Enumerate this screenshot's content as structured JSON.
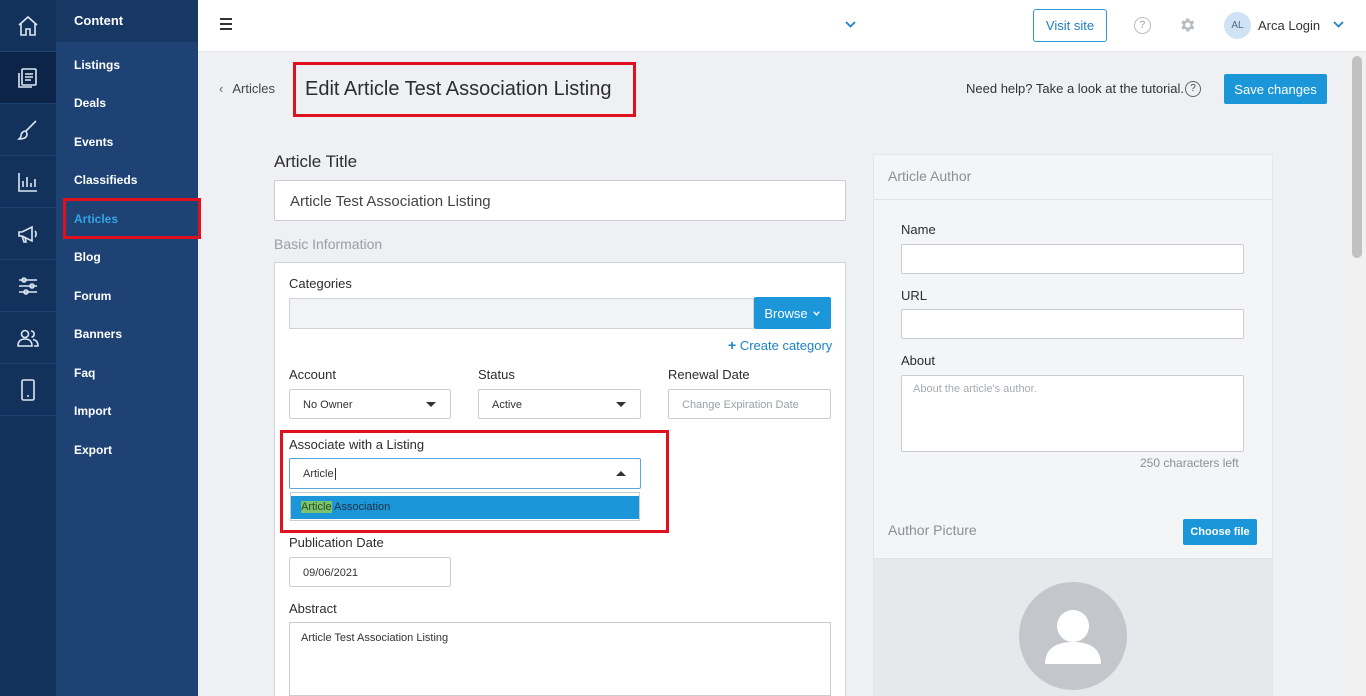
{
  "rail": {
    "items": [
      {
        "icon": "home-icon"
      },
      {
        "icon": "content-icon",
        "active": true
      },
      {
        "icon": "brush-icon"
      },
      {
        "icon": "bar-chart-icon"
      },
      {
        "icon": "megaphone-icon"
      },
      {
        "icon": "sliders-icon"
      },
      {
        "icon": "users-icon"
      },
      {
        "icon": "mobile-icon"
      }
    ]
  },
  "subnav": {
    "heading": "Content",
    "items": [
      {
        "label": "Listings"
      },
      {
        "label": "Deals"
      },
      {
        "label": "Events"
      },
      {
        "label": "Classifieds"
      },
      {
        "label": "Articles",
        "active": true
      },
      {
        "label": "Blog"
      },
      {
        "label": "Forum"
      },
      {
        "label": "Banners"
      },
      {
        "label": "Faq"
      },
      {
        "label": "Import"
      },
      {
        "label": "Export"
      }
    ]
  },
  "topbar": {
    "visit_site": "Visit site",
    "user_initials": "AL",
    "user_name": "Arca Login"
  },
  "header": {
    "back_label": "Articles",
    "title": "Edit Article Test Association Listing",
    "help_text": "Need help? Take a look at the tutorial.",
    "help_q": "?",
    "save_label": "Save changes"
  },
  "form": {
    "article_title_label": "Article Title",
    "article_title_value": "Article Test Association Listing",
    "basic_info_label": "Basic Information",
    "categories_label": "Categories",
    "browse_label": "Browse",
    "create_category_label": "Create category",
    "account_label": "Account",
    "account_value": "No Owner",
    "status_label": "Status",
    "status_value": "Active",
    "renewal_label": "Renewal Date",
    "renewal_placeholder": "Change Expiration Date",
    "associate_label": "Associate with a Listing",
    "associate_value": "Article",
    "dropdown_option_match": "Article",
    "dropdown_option_rest": " Association",
    "publication_label": "Publication Date",
    "publication_value": "09/06/2021",
    "abstract_label": "Abstract",
    "abstract_value": "Article Test Association Listing"
  },
  "author": {
    "heading": "Article Author",
    "name_label": "Name",
    "url_label": "URL",
    "about_label": "About",
    "about_placeholder": "About the article's author.",
    "chars_left": "250 characters left",
    "picture_heading": "Author Picture",
    "choose_file_label": "Choose file"
  },
  "colors": {
    "accent": "#1b96d9",
    "rail_bg": "#12325c",
    "subnav_bg": "#1d4273",
    "highlight_box": "#e0101e"
  }
}
